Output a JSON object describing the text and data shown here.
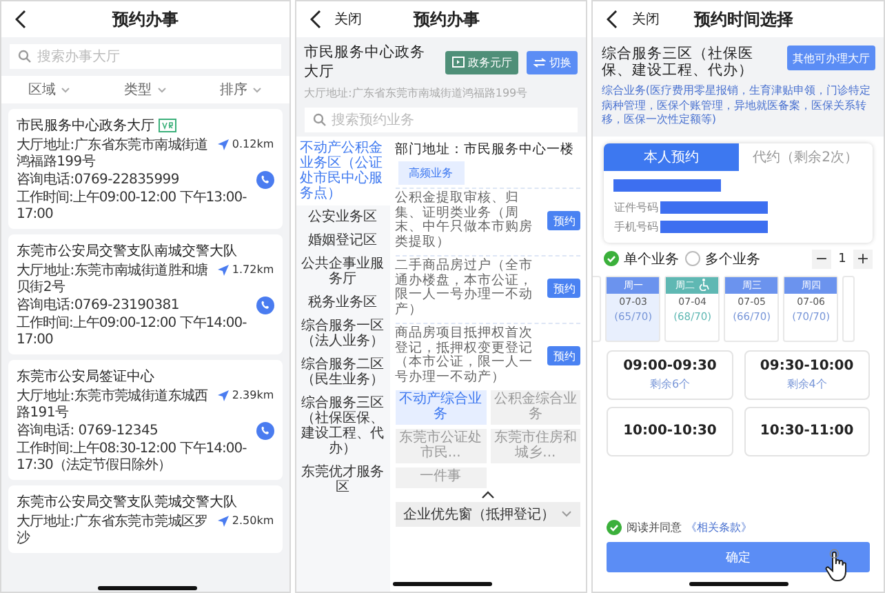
{
  "left": {
    "title": "预约办事",
    "search": {
      "placeholder": "搜索办事大厅"
    },
    "filters": [
      {
        "label": "区域"
      },
      {
        "label": "类型"
      },
      {
        "label": "排序"
      }
    ],
    "cards": [
      {
        "name": "市民服务中心政务大厅",
        "vr": true,
        "address": "大厅地址:广东省东莞市南城街道鸿福路199号",
        "distance": "0.12km",
        "phone": "咨询电话:0769-22835999",
        "hours": "工作时间:上午09:00-12:00 下午13:00-17:00"
      },
      {
        "name": "东莞市公安局交警支队南城交警大队",
        "vr": false,
        "address": "大厅地址:东莞市南城街道胜和塘贝街2号",
        "distance": "1.72km",
        "phone": "咨询电话:0769-23190381",
        "hours": "工作时间:上午09:00-12:00 下午14:00-17:00"
      },
      {
        "name": "东莞市公安局签证中心",
        "vr": false,
        "address": "大厅地址:东莞市莞城街道东城西路191号",
        "distance": "2.39km",
        "phone": "咨询电话: 0769-12345",
        "hours": "工作时间:上午08:30-12:00 下午14:00-17:30（法定节假日除外）"
      },
      {
        "name": "东莞市公安局交警支队莞城交警大队",
        "vr": false,
        "address": "大厅地址:广东省东莞市莞城区罗沙",
        "distance": "2.50km"
      }
    ]
  },
  "middle": {
    "back_label": "关闭",
    "title": "预约办事",
    "hall_name": "市民服务中心政务大厅",
    "buttons": [
      {
        "label": "政务元厅",
        "kind": "hall"
      },
      {
        "label": "切换",
        "kind": "switch"
      }
    ],
    "address": "大厅地址:广东省东莞市南城街道鸿福路199号",
    "search": {
      "placeholder": "搜索预约业务"
    },
    "sidebar": [
      {
        "label": "不动产公积金业务区（公证处市民中心服务点）",
        "selected": true
      },
      {
        "label": "公安业务区",
        "selected": false
      },
      {
        "label": "婚姻登记区",
        "selected": false
      },
      {
        "label": "公共企事业服务厅",
        "selected": false
      },
      {
        "label": "税务业务区",
        "selected": false
      },
      {
        "label": "综合服务一区（法人业务）",
        "selected": false
      },
      {
        "label": "综合服务二区（民生业务）",
        "selected": false
      },
      {
        "label": "综合服务三区（社保医保、建设工程、代办）",
        "selected": false
      },
      {
        "label": "东莞优才服务区",
        "selected": false
      }
    ],
    "dept_address": "部门地址：市民服务中心一楼",
    "category": "高频业务",
    "services": [
      {
        "text": "公积金提取审核、归集、证明类业务（周末、中午只做本市购房类提取）",
        "button": "预约"
      },
      {
        "text": "二手商品房过户（全市通办楼盘，本市公证，限一人一号办理一不动产）",
        "button": "预约"
      },
      {
        "text": "商品房项目抵押权首次登记，抵押权变更登记（本市公证，限一人一号办理一不动产）",
        "button": "预约"
      }
    ],
    "tags": [
      {
        "label": "不动产综合业务",
        "selected": true
      },
      {
        "label": "公积金综合业务",
        "selected": false
      },
      {
        "label": "东莞市公证处市民...",
        "selected": false
      },
      {
        "label": "东莞市住房和城乡...",
        "selected": false
      },
      {
        "label": "一件事",
        "selected": false
      }
    ],
    "dropdown": "企业优先窗（抵押登记）"
  },
  "right": {
    "back_label": "关闭",
    "title": "预约时间选择",
    "zone": "综合服务三区（社保医保、建设工程、代办）",
    "other_button": "其他可办理大厅",
    "description": "综合业务(医疗费用零星报销，生育津贴申领，门诊特定病种管理，医保个账管理，异地就医备案，医保关系转移，医保一次性定额等)",
    "tabs": [
      {
        "label": "本人预约",
        "selected": true
      },
      {
        "label": "代约（剩余2次）",
        "selected": false
      }
    ],
    "fields": [
      {
        "label": "证件号码"
      },
      {
        "label": "手机号码"
      }
    ],
    "options": [
      {
        "label": "单个业务",
        "selected": true
      },
      {
        "label": "多个业务",
        "selected": false
      }
    ],
    "quantity": {
      "minus": "−",
      "value": "1",
      "plus": "+"
    },
    "days": [
      {
        "weekday": "周一",
        "date": "07-03",
        "quota": "(65/70)",
        "accessible": false,
        "selected": true
      },
      {
        "weekday": "周二",
        "date": "07-04",
        "quota": "(68/70)",
        "accessible": true,
        "selected": false
      },
      {
        "weekday": "周三",
        "date": "07-05",
        "quota": "(66/70)",
        "accessible": false,
        "selected": false
      },
      {
        "weekday": "周四",
        "date": "07-06",
        "quota": "(70/70)",
        "accessible": false,
        "selected": false
      }
    ],
    "slots": [
      {
        "time": "09:00-09:30",
        "remaining": "剩余6个"
      },
      {
        "time": "09:30-10:00",
        "remaining": "剩余4个"
      },
      {
        "time": "10:00-10:30"
      },
      {
        "time": "10:30-11:00"
      }
    ],
    "agreement": {
      "checked": true,
      "text": "阅读并同意",
      "link": "《相关条款》"
    },
    "confirm": "确定"
  }
}
